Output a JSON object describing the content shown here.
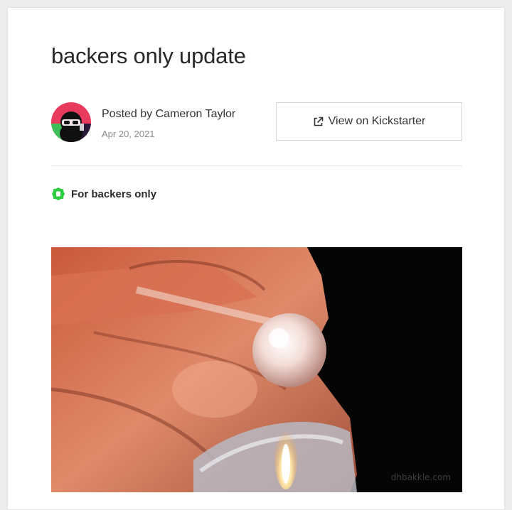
{
  "post": {
    "title": "backers only update",
    "author_line": "Posted by Cameron Taylor",
    "date": "Apr 20, 2021",
    "view_button_label": "View on Kickstarter",
    "view_button_icon": "external-link-icon",
    "backers_badge_label": "For backers only",
    "backers_badge_icon": "lock-badge-icon",
    "media_watermark": "dhbakkle.com"
  },
  "colors": {
    "badge_green": "#2ecc40",
    "text_dark": "#282828",
    "text_muted": "#8c8c8c",
    "avatar_bg": "#e83a5c"
  }
}
